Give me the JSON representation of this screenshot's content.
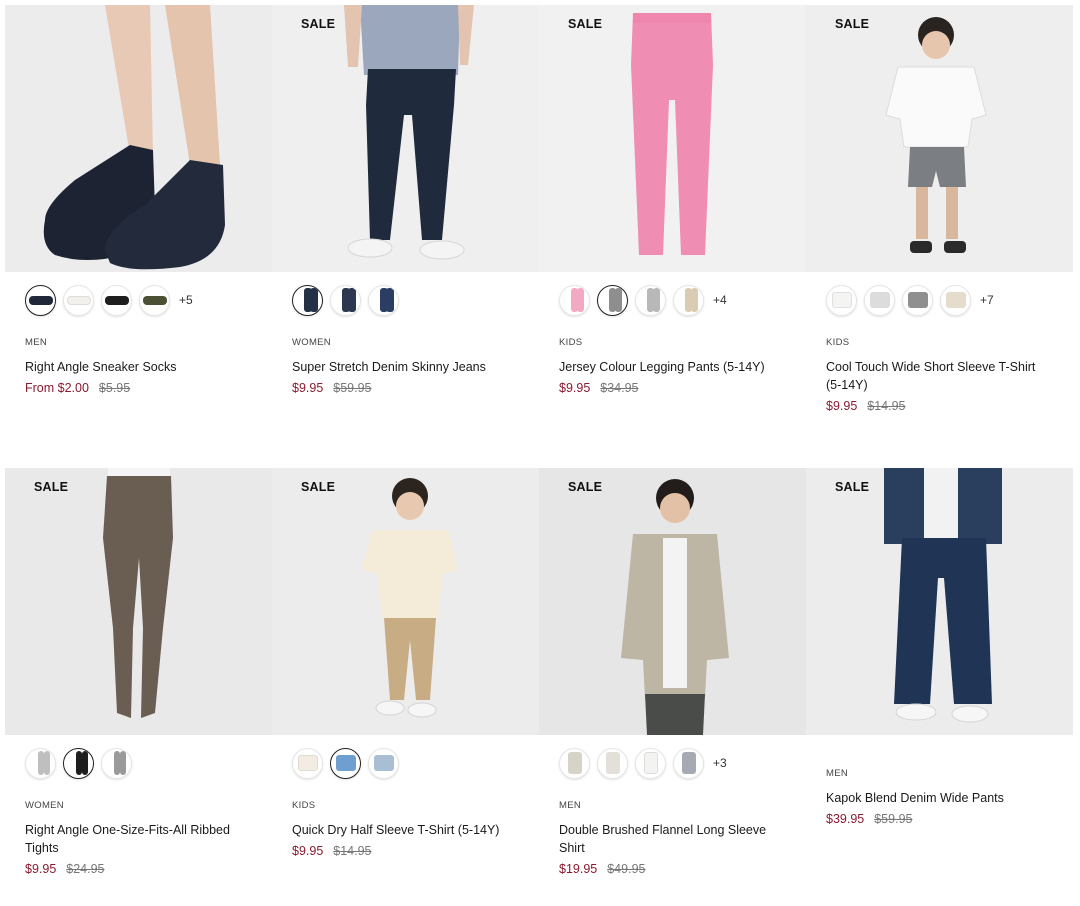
{
  "products": [
    {
      "sale": "",
      "category": "MEN",
      "name": "Right Angle Sneaker Socks",
      "price": "From $2.00",
      "original_price": "$5.95",
      "swatch_colors": [
        "#1f2738",
        "#f3f1ec",
        "#1e1e1e",
        "#4b4f33"
      ],
      "more_colors": "+5"
    },
    {
      "sale": "SALE",
      "category": "WOMEN",
      "name": "Super Stretch Denim Skinny Jeans",
      "price": "$9.95",
      "original_price": "$59.95",
      "swatch_colors": [
        "#243046",
        "#2c3850",
        "#2a3d63"
      ],
      "more_colors": ""
    },
    {
      "sale": "SALE",
      "category": "KIDS",
      "name": "Jersey Colour Legging Pants (5-14Y)",
      "price": "$9.95",
      "original_price": "$34.95",
      "swatch_colors": [
        "#f2a9c4",
        "#8e8e8e",
        "#b8b8b8",
        "#d9cbb4"
      ],
      "more_colors": "+4"
    },
    {
      "sale": "SALE",
      "category": "KIDS",
      "name": "Cool Touch Wide Short Sleeve T-Shirt (5-14Y)",
      "price": "$9.95",
      "original_price": "$14.95",
      "swatch_colors": [
        "#f4f4f2",
        "#dcdcdc",
        "#8f8f8f",
        "#e6dccb"
      ],
      "more_colors": "+7"
    },
    {
      "sale": "SALE",
      "category": "WOMEN",
      "name": "Right Angle One-Size-Fits-All Ribbed Tights",
      "price": "$9.95",
      "original_price": "$24.95",
      "swatch_colors": [
        "#bfbfbf",
        "#1e1e1e",
        "#9a9a9a"
      ],
      "more_colors": ""
    },
    {
      "sale": "SALE",
      "category": "KIDS",
      "name": "Quick Dry Half Sleeve T-Shirt (5-14Y)",
      "price": "$9.95",
      "original_price": "$14.95",
      "swatch_colors": [
        "#f2ece2",
        "#6f9fd0",
        "#a9bdd3"
      ],
      "more_colors": ""
    },
    {
      "sale": "SALE",
      "category": "MEN",
      "name": "Double Brushed Flannel Long Sleeve Shirt",
      "price": "$19.95",
      "original_price": "$49.95",
      "swatch_colors": [
        "#d8d3c8",
        "#e3e0da",
        "#f3f3f1",
        "#a6aab2"
      ],
      "more_colors": "+3"
    },
    {
      "sale": "SALE",
      "category": "MEN",
      "name": "Kapok Blend Denim Wide Pants",
      "price": "$39.95",
      "original_price": "$59.95",
      "swatch_colors": [],
      "more_colors": ""
    }
  ],
  "colors": {
    "price": "#8a1a30",
    "original_price": "#777777",
    "image_background": "#ebebeb"
  }
}
